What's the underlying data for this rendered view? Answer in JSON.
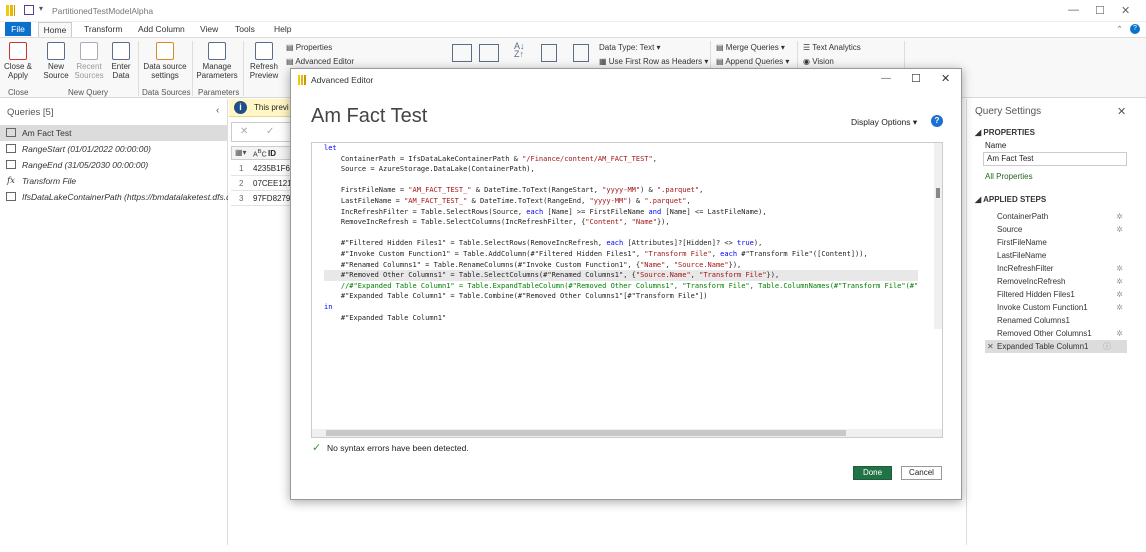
{
  "window": {
    "title": "PartitionedTestModelAlpha"
  },
  "tabs": [
    "File",
    "Home",
    "Transform",
    "Add Column",
    "View",
    "Tools",
    "Help"
  ],
  "ribbon": {
    "close_apply": "Close &\nApply",
    "new_source": "New\nSource",
    "recent_sources": "Recent\nSources",
    "enter_data": "Enter\nData",
    "data_source_settings": "Data source\nsettings",
    "manage_parameters": "Manage\nParameters",
    "refresh_preview": "Refresh\nPreview",
    "properties": "Properties",
    "advanced_editor": "Advanced Editor",
    "data_type": "Data Type: Text",
    "first_row_headers": "Use First Row as Headers",
    "merge_queries": "Merge Queries",
    "append_queries": "Append Queries",
    "text_analytics": "Text Analytics",
    "vision": "Vision",
    "groups": {
      "close": "Close",
      "new_query": "New Query",
      "data_sources": "Data Sources",
      "parameters": "Parameters"
    }
  },
  "queries": {
    "header": "Queries [5]",
    "items": [
      "Am Fact Test",
      "RangeStart (01/01/2022 00:00:00)",
      "RangeEnd (31/05/2030 00:00:00)",
      "Transform File",
      "IfsDataLakeContainerPath (https://bmdatalaketest.dfs.cor..."
    ]
  },
  "preview": {
    "warning": "This previ",
    "column": "ID",
    "rows": [
      {
        "n": "1",
        "v": "4235B1F6B"
      },
      {
        "n": "2",
        "v": "07CEE121C"
      },
      {
        "n": "3",
        "v": "97FD8279D"
      }
    ]
  },
  "settings": {
    "header": "Query Settings",
    "properties": "PROPERTIES",
    "name_label": "Name",
    "name_value": "Am Fact Test",
    "all_properties": "All Properties",
    "applied_steps": "APPLIED STEPS",
    "steps": [
      "ContainerPath",
      "Source",
      "FirstFileName",
      "LastFileName",
      "IncRefreshFilter",
      "RemoveIncRefresh",
      "Filtered Hidden Files1",
      "Invoke Custom Function1",
      "Renamed Columns1",
      "Removed Other Columns1",
      "Expanded Table Column1"
    ]
  },
  "dialog": {
    "title": "Advanced Editor",
    "query_name": "Am Fact Test",
    "display_options": "Display Options",
    "status": "No syntax errors have been detected.",
    "done": "Done",
    "cancel": "Cancel"
  },
  "code": [
    "let",
    "    ContainerPath = IfsDataLakeContainerPath & \"/Finance/content/AM_FACT_TEST\",",
    "    Source = AzureStorage.DataLake(ContainerPath),",
    "",
    "    FirstFileName = \"AM_FACT_TEST_\" & DateTime.ToText(RangeStart, \"yyyy-MM\") & \".parquet\",",
    "    LastFileName = \"AM_FACT_TEST_\" & DateTime.ToText(RangeEnd, \"yyyy-MM\") & \".parquet\",",
    "    IncRefreshFilter = Table.SelectRows(Source, each [Name] >= FirstFileName and [Name] <= LastFileName),",
    "    RemoveIncRefresh = Table.SelectColumns(IncRefreshFilter, {\"Content\", \"Name\"}),",
    "",
    "    #\"Filtered Hidden Files1\" = Table.SelectRows(RemoveIncRefresh, each [Attributes]?[Hidden]? <> true),",
    "    #\"Invoke Custom Function1\" = Table.AddColumn(#\"Filtered Hidden Files1\", \"Transform File\", each #\"Transform File\"([Content])),",
    "    #\"Renamed Columns1\" = Table.RenameColumns(#\"Invoke Custom Function1\", {\"Name\", \"Source.Name\"}),",
    "    #\"Removed Other Columns1\" = Table.SelectColumns(#\"Renamed Columns1\", {\"Source.Name\", \"Transform File\"}),",
    "    //#\"Expanded Table Column1\" = Table.ExpandTableColumn(#\"Removed Other Columns1\", \"Transform File\", Table.ColumnNames(#\"Transform File\"(#\"",
    "    #\"Expanded Table Column1\" = Table.Combine(#\"Removed Other Columns1\"[#\"Transform File\"])",
    "in",
    "    #\"Expanded Table Column1\""
  ]
}
